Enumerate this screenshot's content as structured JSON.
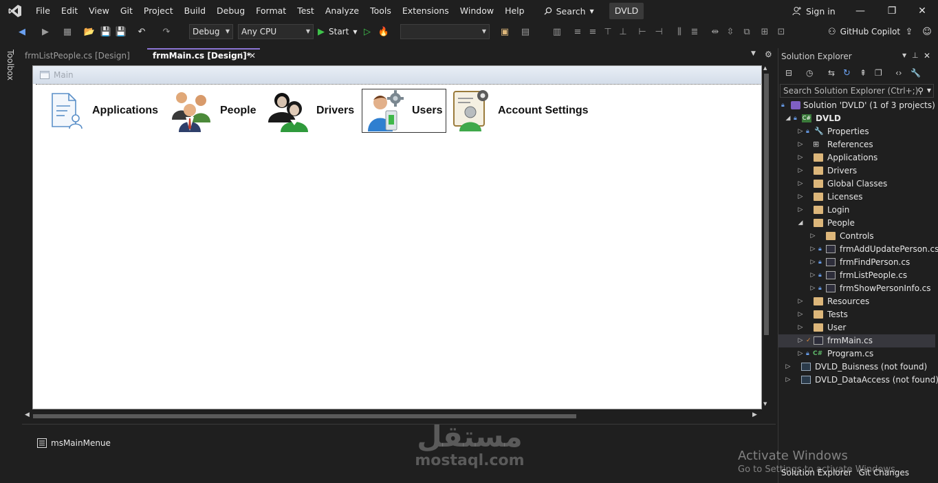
{
  "menubar": {
    "items": [
      "File",
      "Edit",
      "View",
      "Git",
      "Project",
      "Build",
      "Debug",
      "Format",
      "Test",
      "Analyze",
      "Tools",
      "Extensions",
      "Window",
      "Help"
    ],
    "search_label": "Search",
    "solution_name": "DVLD",
    "signin_label": "Sign in"
  },
  "toolbar": {
    "config": "Debug",
    "platform": "Any CPU",
    "start_label": "Start",
    "copilot_label": "GitHub Copilot"
  },
  "toolbox_label": "Toolbox",
  "doc_tabs": [
    {
      "label": "frmListPeople.cs [Design]",
      "active": false
    },
    {
      "label": "frmMain.cs [Design]*",
      "active": true
    }
  ],
  "form": {
    "title": "Main",
    "menu_items": [
      "Applications",
      "People",
      "Drivers",
      "Users",
      "Account Settings"
    ]
  },
  "tray": {
    "component": "msMainMenue"
  },
  "solution_explorer": {
    "title": "Solution Explorer",
    "search_placeholder": "Search Solution Explorer (Ctrl+;)",
    "solution_label": "Solution 'DVLD' (1 of 3 projects)",
    "project": "DVLD",
    "nodes": [
      "Properties",
      "References",
      "Applications",
      "Drivers",
      "Global Classes",
      "Licenses",
      "Login",
      "People",
      "Controls",
      "frmAddUpdatePerson.cs",
      "frmFindPerson.cs",
      "frmListPeople.cs",
      "frmShowPersonInfo.cs",
      "Resources",
      "Tests",
      "User",
      "frmMain.cs",
      "Program.cs"
    ],
    "other_projects": [
      "DVLD_Buisness (not found)",
      "DVLD_DataAccess (not found)"
    ],
    "bottom_tabs": [
      "Solution Explorer",
      "Git Changes"
    ]
  },
  "activate": {
    "line1": "Activate Windows",
    "line2": "Go to Settings to activate Windows."
  },
  "watermark": {
    "arabic": "مستقل",
    "latin": "mostaql.com"
  },
  "colors": {
    "background": "#1f1f1f",
    "accent": "#8d76d6",
    "folder": "#dcb67a",
    "lock": "#6aa0f0"
  }
}
